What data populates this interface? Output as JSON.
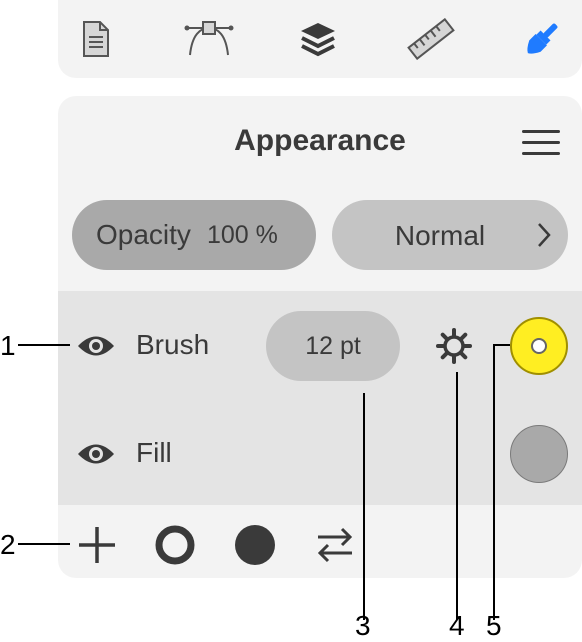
{
  "toolbar": {
    "tools": [
      {
        "icon": "document-icon"
      },
      {
        "icon": "bezier-pen-icon"
      },
      {
        "icon": "layers-icon"
      },
      {
        "icon": "ruler-icon"
      },
      {
        "icon": "brush-icon",
        "active": true
      }
    ]
  },
  "panel": {
    "title": "Appearance",
    "opacity": {
      "label": "Opacity",
      "value": "100 %"
    },
    "blend_mode": "Normal"
  },
  "layers": [
    {
      "name": "Brush",
      "size": "12 pt",
      "swatch_color": "#ffee22",
      "visible": true
    },
    {
      "name": "Fill",
      "swatch_color": "#a9a9a9",
      "visible": true
    }
  ],
  "colors": {
    "accent": "#1f7bff",
    "panel_bg": "#f3f3f3",
    "layer_bg": "#e4e4e4"
  },
  "callouts": [
    "1",
    "2",
    "3",
    "4",
    "5"
  ]
}
